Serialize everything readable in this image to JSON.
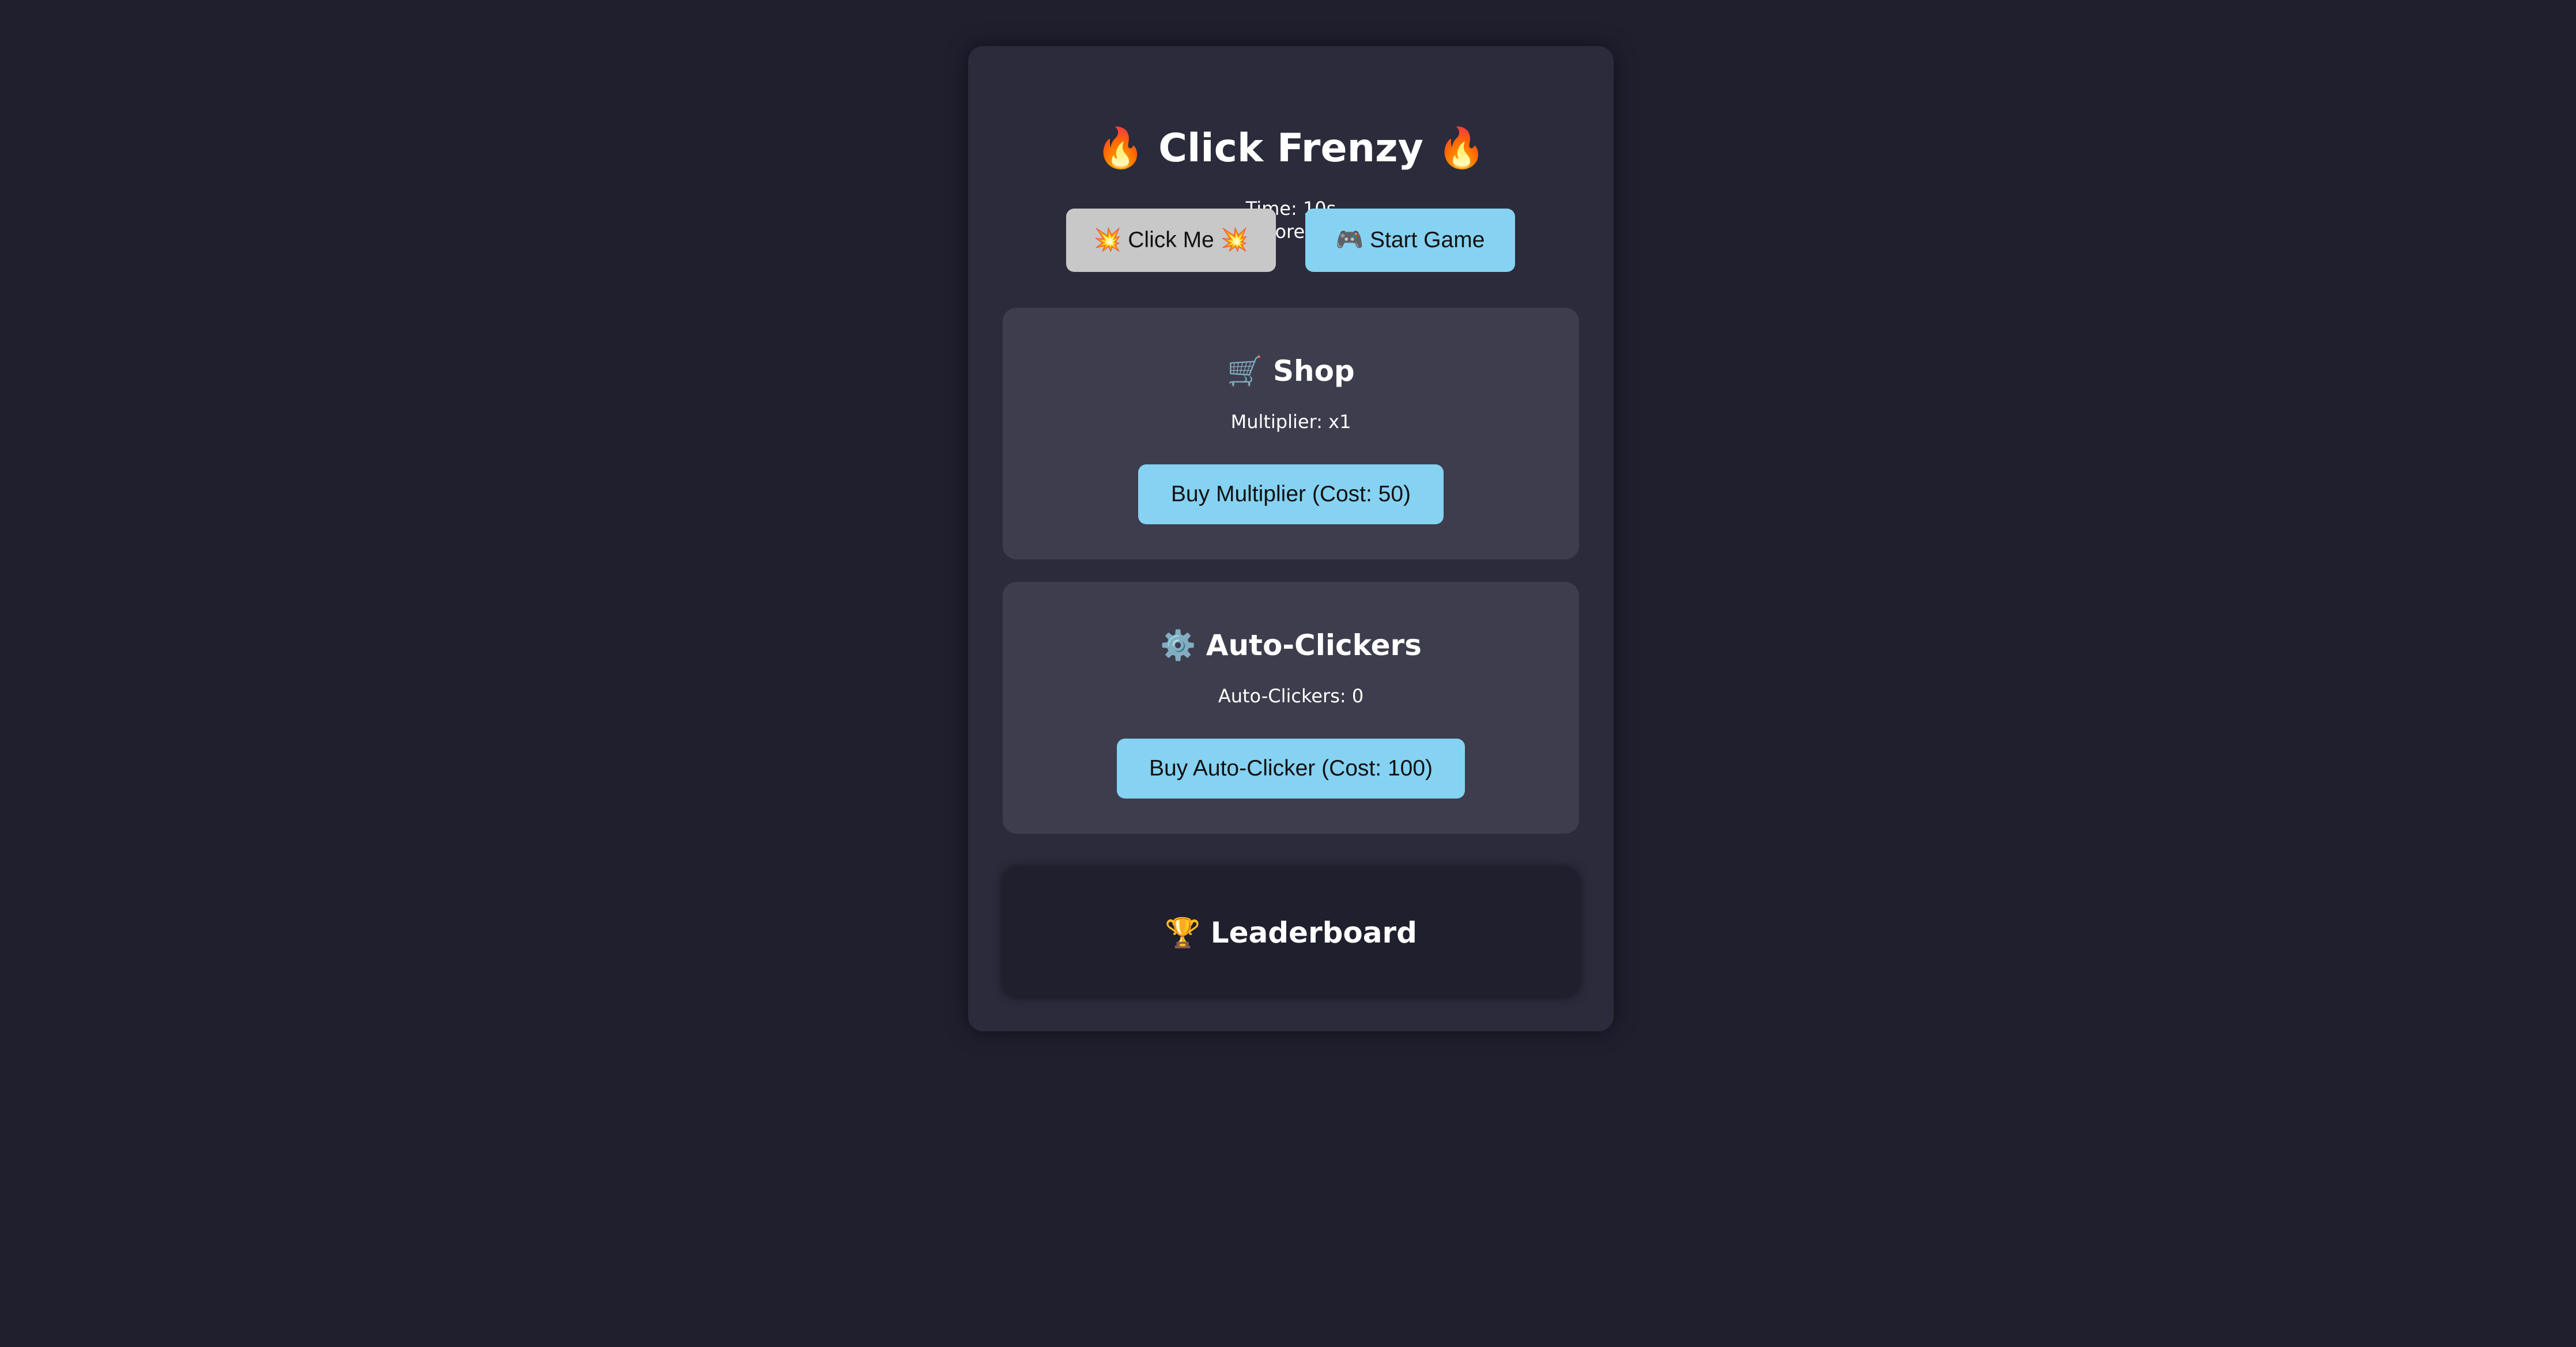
{
  "game": {
    "title_left_icon": "🔥",
    "title": "Click Frenzy",
    "title_right_icon": "🔥",
    "time_label": "Time: 10s",
    "score_label": "Score: 0",
    "click_button": "💥 Click Me 💥",
    "start_button": "🎮 Start Game"
  },
  "shop": {
    "icon": "🛒",
    "title": "Shop",
    "multiplier_text": "Multiplier: x1",
    "buy_button": "Buy Multiplier (Cost: 50)"
  },
  "auto_clickers": {
    "icon": "⚙️",
    "title": "Auto-Clickers",
    "count_text": "Auto-Clickers: 0",
    "buy_button": "Buy Auto-Clicker (Cost: 100)"
  },
  "leaderboard": {
    "icon": "🏆",
    "title": "Leaderboard"
  },
  "colors": {
    "page_background": "#1f1f2e",
    "card_background": "#2b2b3b",
    "panel_background": "#3d3d4d",
    "accent_button": "#86d2f2",
    "neutral_button": "#c8c8c8"
  }
}
